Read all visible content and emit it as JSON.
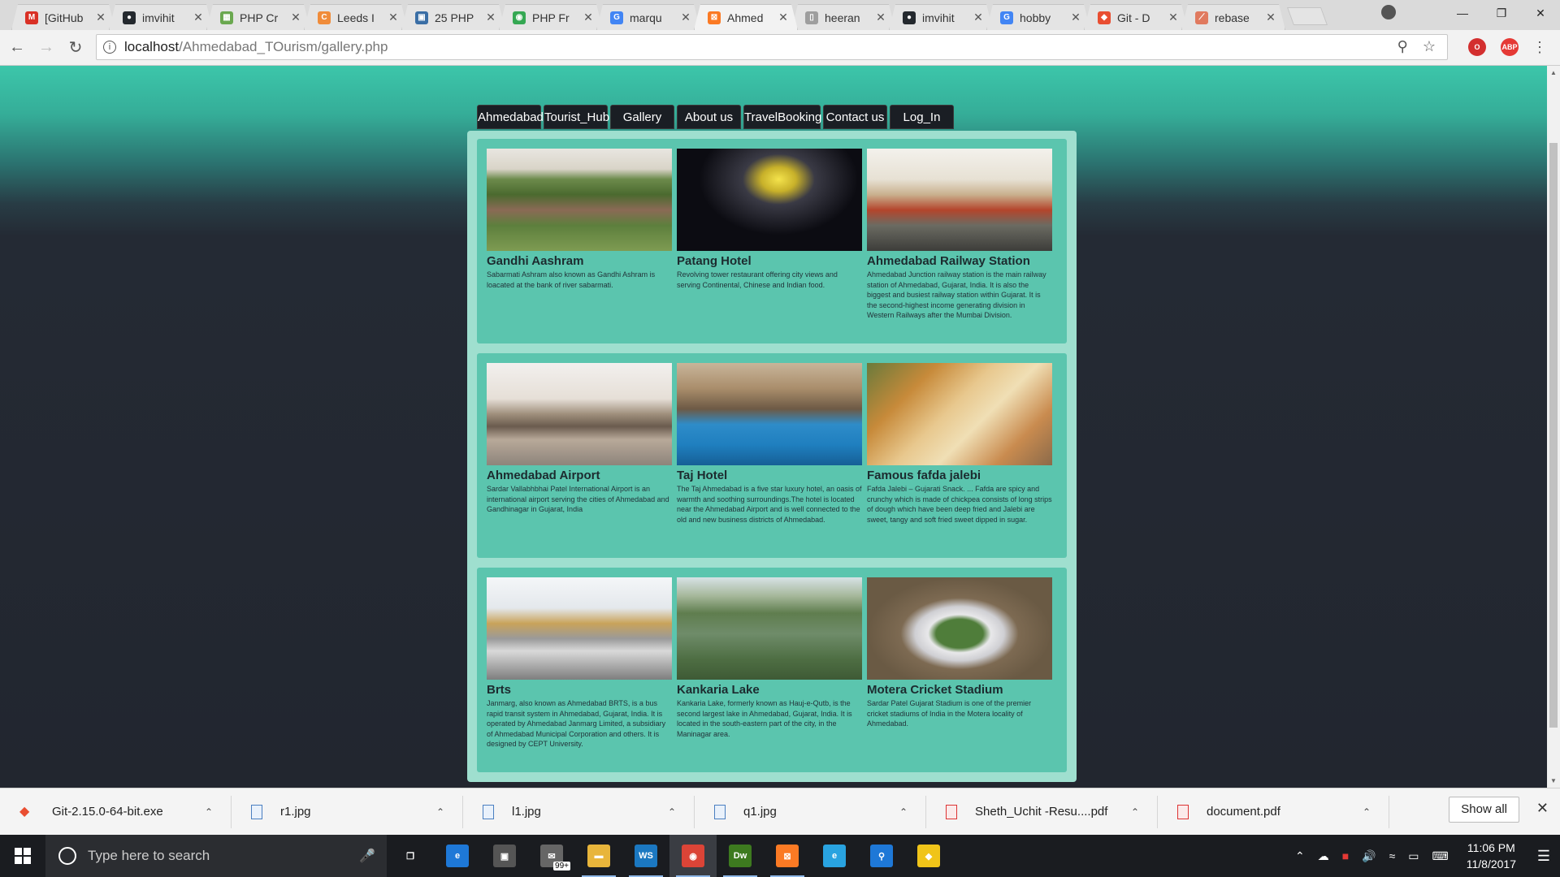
{
  "browser": {
    "tabs": [
      {
        "title": "[GitHub",
        "icon": "gmail-icon",
        "color": "#d93025",
        "glyph": "M"
      },
      {
        "title": "imvihit",
        "icon": "github-icon",
        "color": "#24292e",
        "glyph": "●"
      },
      {
        "title": "PHP Cr",
        "icon": "site-icon",
        "color": "#6aa84f",
        "glyph": "▦"
      },
      {
        "title": "Leeds I",
        "icon": "site-icon",
        "color": "#f08c3a",
        "glyph": "C"
      },
      {
        "title": "25 PHP",
        "icon": "site-icon",
        "color": "#3a6ea5",
        "glyph": "▣"
      },
      {
        "title": "PHP Fr",
        "icon": "site-icon",
        "color": "#35a853",
        "glyph": "◉"
      },
      {
        "title": "marqu",
        "icon": "google-icon",
        "color": "#4285f4",
        "glyph": "G"
      },
      {
        "title": "Ahmed",
        "icon": "xampp-icon",
        "color": "#fb7a24",
        "glyph": "⊠",
        "active": true
      },
      {
        "title": "heeran",
        "icon": "document-icon",
        "color": "#9e9e9e",
        "glyph": "▯"
      },
      {
        "title": "imvihit",
        "icon": "github-icon",
        "color": "#24292e",
        "glyph": "●"
      },
      {
        "title": "hobby",
        "icon": "google-icon",
        "color": "#4285f4",
        "glyph": "G"
      },
      {
        "title": "Git - D",
        "icon": "git-icon",
        "color": "#e94e31",
        "glyph": "◆"
      },
      {
        "title": "rebase",
        "icon": "site-icon",
        "color": "#e07a5f",
        "glyph": "⟋"
      }
    ],
    "url_host": "localhost",
    "url_path": "/Ahmedabad_TOurism/gallery.php"
  },
  "nav": [
    {
      "label": "Ahmedabad",
      "width": 79
    },
    {
      "label": "Tourist_Hub",
      "width": 79
    },
    {
      "label": "Gallery",
      "width": 79
    },
    {
      "label": "About us",
      "width": 79
    },
    {
      "label": "TravelBooking",
      "width": 95
    },
    {
      "label": "Contact us",
      "width": 79
    },
    {
      "label": "Log_In",
      "width": 79
    }
  ],
  "gallery": [
    [
      {
        "title": "Gandhi Aashram",
        "desc": "Sabarmati Ashram also known as Gandhi Ashram is loacated at the bank of river sabarmati.",
        "img": "ashram"
      },
      {
        "title": "Patang Hotel",
        "desc": "Revolving tower restaurant offering city views and serving Continental, Chinese and Indian food.",
        "img": "patang"
      },
      {
        "title": "Ahmedabad Railway Station",
        "desc": "Ahmedabad Junction railway station is the main railway station of Ahmedabad, Gujarat, India. It is also the biggest and busiest railway station within Gujarat. It is the second-highest income generating division in Western Railways after the Mumbai Division.",
        "img": "railway"
      }
    ],
    [
      {
        "title": "Ahmedabad Airport",
        "desc": "Sardar Vallabhbhai Patel International Airport is an international airport serving the cities of Ahmedabad and Gandhinagar in Gujarat, India",
        "img": "airport"
      },
      {
        "title": "Taj Hotel",
        "desc": "The Taj Ahmedabad is a five star luxury hotel, an oasis of warmth and soothing surroundings.The hotel is located near the Ahmedabad Airport and is well connected to the old and new business districts of Ahmedabad.",
        "img": "taj"
      },
      {
        "title": "Famous fafda jalebi",
        "desc": "Fafda Jalebi – Gujarati Snack. ... Fafda are spicy and crunchy which is made of chickpea consists of long strips of dough which have been deep fried and Jalebi are sweet, tangy and soft fried sweet dipped in sugar.",
        "img": "fafda"
      }
    ],
    [
      {
        "title": "Brts",
        "desc": "Janmarg, also known as Ahmedabad BRTS, is a bus rapid transit system in Ahmedabad, Gujarat, India. It is operated by Ahmedabad Janmarg Limited, a subsidiary of Ahmedabad Municipal Corporation and others. It is designed by CEPT University.",
        "img": "brts"
      },
      {
        "title": "Kankaria Lake",
        "desc": "Kankaria Lake, formerly known as Hauj-e-Qutb, is the second largest lake in Ahmedabad, Gujarat, India. It is located in the south-eastern part of the city, in the Maninagar area.",
        "img": "lake"
      },
      {
        "title": "Motera Cricket Stadium",
        "desc": "Sardar Patel Gujarat Stadium is one of the premier cricket stadiums of India in the Motera locality of Ahmedabad.",
        "img": "stadium"
      }
    ]
  ],
  "downloads": [
    {
      "name": "Git-2.15.0-64-bit.exe",
      "kind": "git"
    },
    {
      "name": "r1.jpg",
      "kind": "jpg"
    },
    {
      "name": "l1.jpg",
      "kind": "jpg"
    },
    {
      "name": "q1.jpg",
      "kind": "jpg"
    },
    {
      "name": "Sheth_Uchit -Resu....pdf",
      "kind": "pdf"
    },
    {
      "name": "document.pdf",
      "kind": "pdf"
    }
  ],
  "show_all": "Show all",
  "taskbar": {
    "search_placeholder": "Type here to search",
    "mail_badge": "99+",
    "time": "11:06 PM",
    "date": "11/8/2017",
    "apps": [
      {
        "name": "task-view-icon",
        "glyph": "❐",
        "color": "transparent"
      },
      {
        "name": "edge-icon",
        "glyph": "e",
        "color": "#1e78d7"
      },
      {
        "name": "store-icon",
        "glyph": "▣",
        "color": "#555"
      },
      {
        "name": "mail-icon",
        "glyph": "✉",
        "color": "#666",
        "badge": true
      },
      {
        "name": "file-explorer-icon",
        "glyph": "▬",
        "color": "#e8b53b",
        "running": true
      },
      {
        "name": "webstorm-icon",
        "glyph": "WS",
        "color": "#1b78c1",
        "running": true
      },
      {
        "name": "chrome-icon",
        "glyph": "◉",
        "color": "#db4437",
        "running": true,
        "active": true
      },
      {
        "name": "dreamweaver-icon",
        "glyph": "Dw",
        "color": "#3d7a1f",
        "running": true
      },
      {
        "name": "xampp-icon",
        "glyph": "⊠",
        "color": "#fb7a24",
        "running": true
      },
      {
        "name": "ie-icon",
        "glyph": "e",
        "color": "#29a3e0"
      },
      {
        "name": "maps-icon",
        "glyph": "⚲",
        "color": "#1e78d7"
      },
      {
        "name": "git-gui-icon",
        "glyph": "◆",
        "color": "#f0c419"
      }
    ]
  }
}
